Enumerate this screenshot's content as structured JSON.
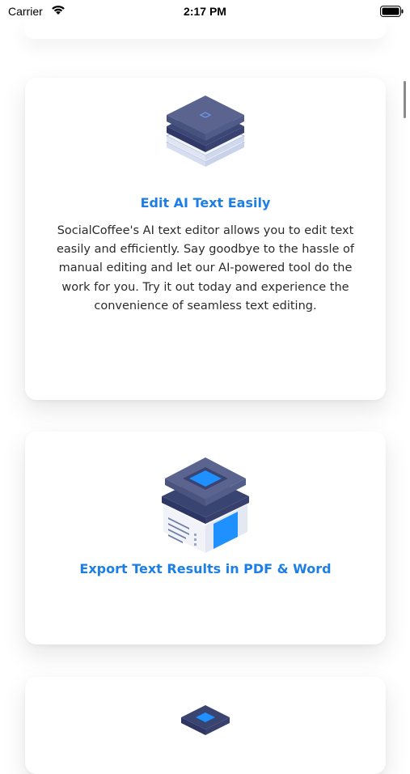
{
  "status_bar": {
    "carrier": "Carrier",
    "time": "2:17 PM"
  },
  "cards": [
    {
      "icon": "layers-stack-icon",
      "title": "Edit AI Text Easily",
      "description": "SocialCoffee's AI text editor allows you to edit text easily and efficiently. Say goodbye to the hassle of manual editing and let our AI-powered tool do the work for you. Try it out today and experience the convenience of seamless text editing."
    },
    {
      "icon": "document-export-icon",
      "title": "Export Text Results in PDF & Word"
    },
    {
      "icon": "layers-stack-icon"
    }
  ],
  "colors": {
    "accent": "#1d7fe5",
    "icon_dark": "#4a5580",
    "icon_blue": "#1e90ff"
  }
}
